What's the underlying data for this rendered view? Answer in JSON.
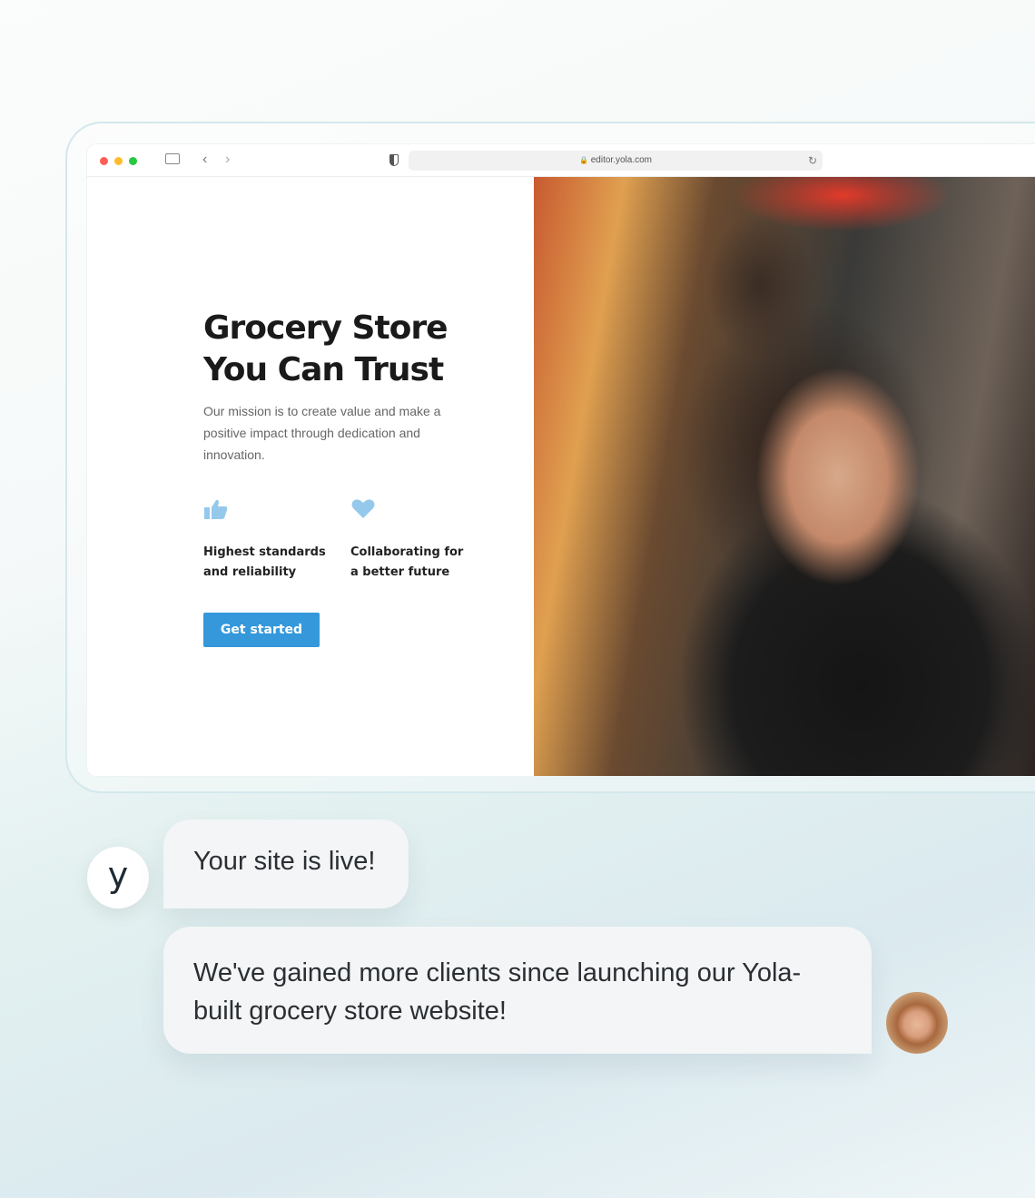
{
  "browser": {
    "url": "editor.yola.com",
    "traffic_lights": [
      "#ff5f57",
      "#febc2e",
      "#28c840"
    ]
  },
  "site": {
    "title_line1": "Grocery Store",
    "title_line2": "You Can Trust",
    "description": "Our mission is to create value and make a positive impact through dedication and innovation.",
    "features": [
      {
        "icon": "thumbs-up-icon",
        "line1": "Highest standards",
        "line2": "and reliability"
      },
      {
        "icon": "heart-icon",
        "line1": "Collaborating for",
        "line2": "a better future"
      }
    ],
    "cta": "Get started",
    "accent": "#3498db",
    "icon_color": "#94c9ec"
  },
  "chat": {
    "logo": "y",
    "message1": "Your site is live!",
    "message2": "We've gained more clients since launching our Yola-built grocery store website!"
  }
}
